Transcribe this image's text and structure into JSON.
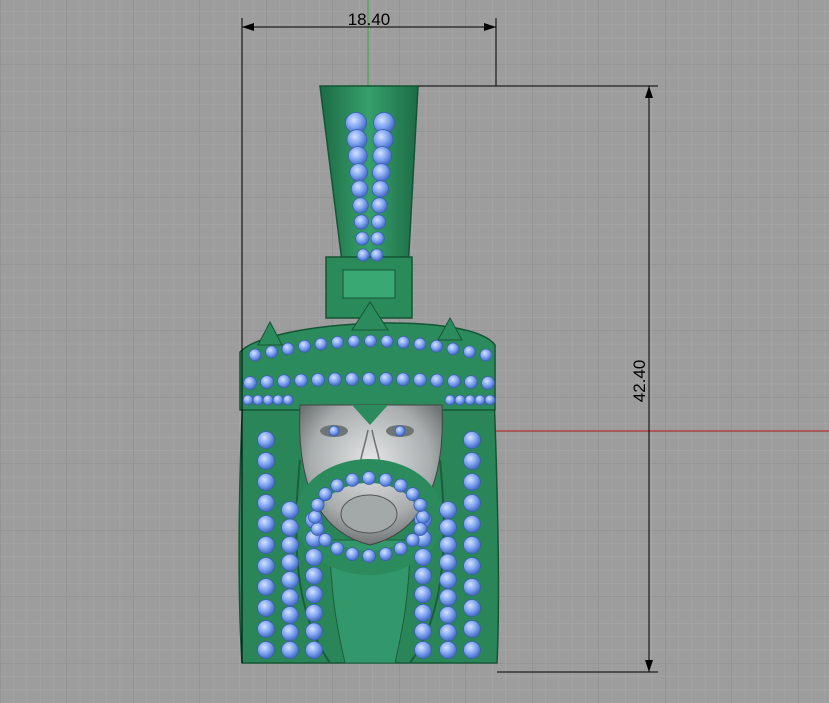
{
  "viewport": {
    "dimensions": {
      "width_label": "18.40",
      "height_label": "42.40"
    },
    "colors": {
      "background": "#9d9d9d",
      "grid_minor": "#a8a8a8",
      "grid_major": "#8a8a8a",
      "model": "#2e8a5e",
      "model_dark": "#1f6d48",
      "gems": "#7fa4f0",
      "face": "#b9bcbd",
      "x_axis": "#b03030",
      "y_axis": "#3fae3f",
      "dimension_line": "#000000"
    },
    "model": {
      "name": "pendant-model",
      "icon": "pendant-3d-model"
    }
  }
}
